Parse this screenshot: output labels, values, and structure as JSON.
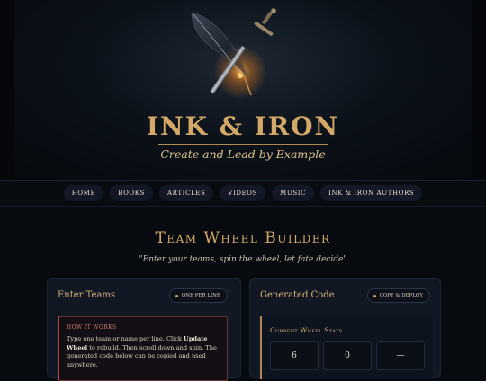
{
  "brand": {
    "title": "INK & IRON",
    "tagline": "Create and Lead by Example"
  },
  "nav": {
    "items": [
      {
        "label": "Home"
      },
      {
        "label": "Books"
      },
      {
        "label": "Articles"
      },
      {
        "label": "Videos"
      },
      {
        "label": "Music"
      },
      {
        "label": "Ink & Iron Authors"
      }
    ]
  },
  "page": {
    "title": "Team Wheel Builder",
    "subtitle": "\"Enter your teams, spin the wheel, let fate decide\""
  },
  "enter_teams": {
    "title": "Enter Teams",
    "pill_label": "One Per Line",
    "how_title": "How it works",
    "how_text_1": "Type one team or name per line. Click ",
    "how_text_bold": "Update Wheel",
    "how_text_2": " to rebuild. Then scroll down and spin. The generated code below can be copied and used anywhere."
  },
  "generated_code": {
    "title": "Generated Code",
    "pill_label": "Copy & Deploy",
    "stats_title": "Current Wheel Stats",
    "stats": [
      "6",
      "0",
      "—"
    ]
  },
  "colors": {
    "accent_gold": "#d4a867",
    "background": "#070a0f",
    "panel": "#111824",
    "warning_red": "#b04a4a"
  },
  "icons": {
    "emblem": "quill-and-sword-icon",
    "pill_dot": "dot-icon"
  }
}
